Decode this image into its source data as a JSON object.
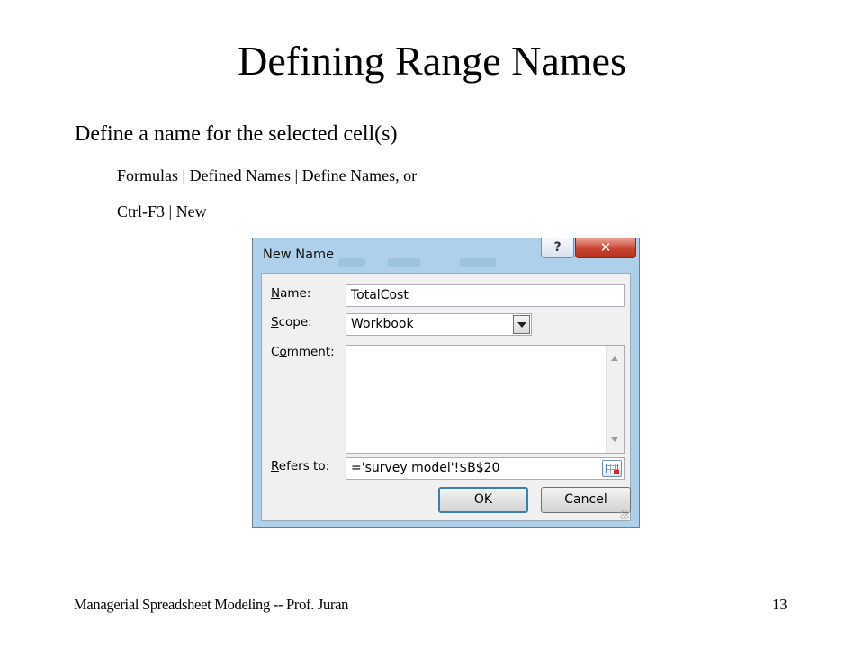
{
  "slide": {
    "title": "Defining Range Names",
    "bullet": "Define a name for the selected cell(s)",
    "sub_bullets": [
      "Formulas | Defined Names | Define Names, or",
      "Ctrl-F3 | New"
    ],
    "footer_text": "Managerial Spreadsheet Modeling -- Prof. Juran",
    "page_number": "13"
  },
  "dialog": {
    "title": "New Name",
    "help_label": "?",
    "close_label": "✕",
    "name_label_key": "N",
    "name_label_rest": "ame:",
    "name_value": "TotalCost",
    "scope_label_key": "S",
    "scope_label_rest": "cope:",
    "scope_value": "Workbook",
    "comment_label_pre": "C",
    "comment_label_key": "o",
    "comment_label_rest": "mment:",
    "comment_value": "",
    "refers_label_key": "R",
    "refers_label_rest": "efers to:",
    "refers_value": "='survey model'!$B$20",
    "ok_label": "OK",
    "cancel_label": "Cancel"
  },
  "colors": {
    "frame": "#aed0ea",
    "close_button": "#c8432f",
    "default_button_border": "#3c7fb1"
  }
}
